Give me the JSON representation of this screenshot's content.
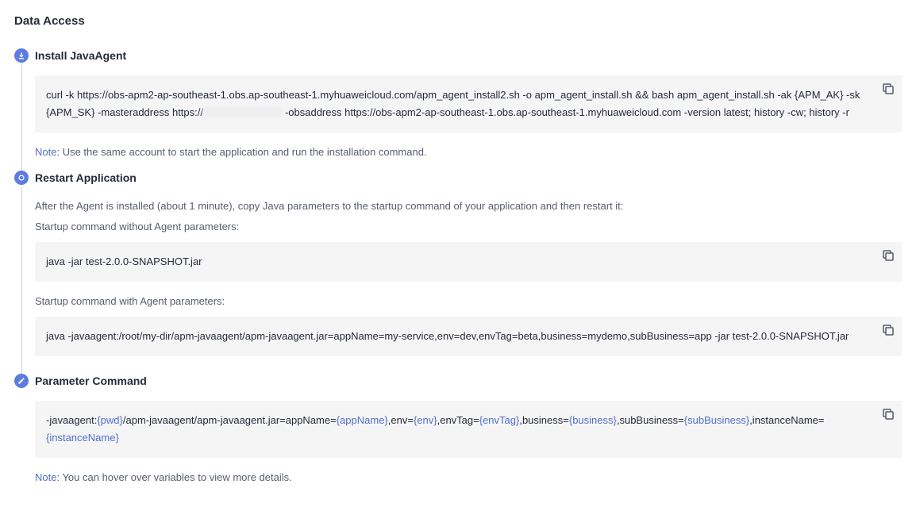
{
  "page_title": "Data Access",
  "steps": [
    {
      "title": "Install JavaAgent",
      "icon": "download",
      "code1_parts": [
        {
          "t": "plain",
          "v": "curl -k https://obs-apm2-ap-southeast-1.obs.ap-southeast-1.myhuaweicloud.com/apm_agent_install2.sh -o apm_agent_install.sh && bash apm_agent_install.sh -ak {APM_AK} -sk {APM_SK} -masteraddress https://"
        },
        {
          "t": "blur",
          "v": "xxx.xxx.xxx.xxxx"
        },
        {
          "t": "plain",
          "v": " -obsaddress https://obs-apm2-ap-southeast-1.obs.ap-southeast-1.myhuaweicloud.com -version latest; history -cw; history -r"
        }
      ],
      "note_label": "Note",
      "note_text": ": Use the same account to start the application and run the installation command."
    },
    {
      "title": "Restart Application",
      "icon": "refresh",
      "intro1": "After the Agent is installed (about 1 minute), copy Java parameters to the startup command of your application and then restart it:",
      "intro2": "Startup command without Agent parameters:",
      "code1": "java -jar test-2.0.0-SNAPSHOT.jar",
      "intro3": "Startup command with Agent parameters:",
      "code2": "java -javaagent:/root/my-dir/apm-javaagent/apm-javaagent.jar=appName=my-service,env=dev,envTag=beta,business=mydemo,subBusiness=app -jar test-2.0.0-SNAPSHOT.jar"
    },
    {
      "title": "Parameter Command",
      "icon": "edit",
      "code_parts": [
        {
          "t": "plain",
          "v": "-javaagent:"
        },
        {
          "t": "var",
          "v": "{pwd}"
        },
        {
          "t": "plain",
          "v": "/apm-javaagent/apm-javaagent.jar=appName="
        },
        {
          "t": "var",
          "v": "{appName}"
        },
        {
          "t": "plain",
          "v": ",env="
        },
        {
          "t": "var",
          "v": "{env}"
        },
        {
          "t": "plain",
          "v": ",envTag="
        },
        {
          "t": "var",
          "v": "{envTag}"
        },
        {
          "t": "plain",
          "v": ",business="
        },
        {
          "t": "var",
          "v": "{business}"
        },
        {
          "t": "plain",
          "v": ",subBusiness="
        },
        {
          "t": "var",
          "v": "{subBusiness}"
        },
        {
          "t": "plain",
          "v": ",instanceName="
        },
        {
          "t": "var",
          "v": "{instanceName}"
        }
      ],
      "note_label": "Note",
      "note_text": ": You can hover over variables to view more details."
    }
  ]
}
